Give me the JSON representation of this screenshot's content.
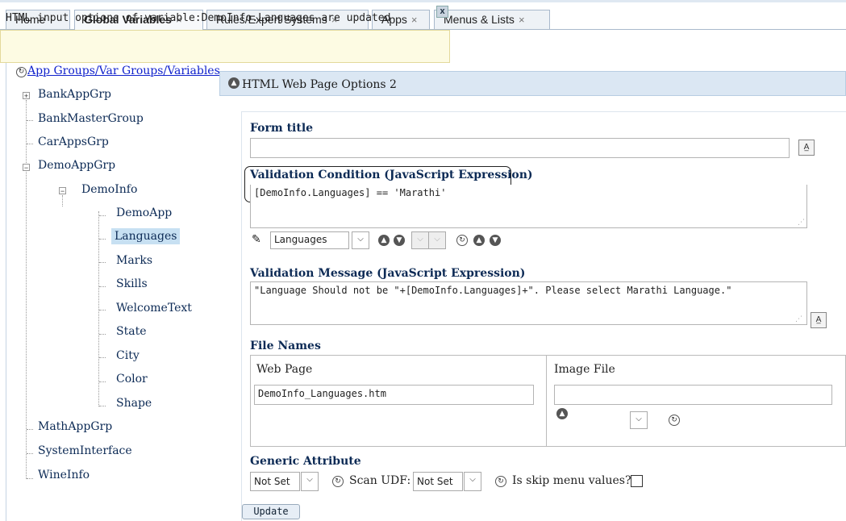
{
  "tabs": [
    {
      "label": "Home"
    },
    {
      "label": "Global Variables",
      "close": "×"
    },
    {
      "label": "Rules/Expert Systems",
      "close": "×"
    },
    {
      "label": "Apps",
      "close": "×"
    },
    {
      "label": "Menus & Lists",
      "close": "×"
    }
  ],
  "notice": {
    "text": "HTML input options of variable:DemoInfo.Languages are updated",
    "close": "x"
  },
  "tree": {
    "root": "App Groups/Var Groups/Variables",
    "nodes": [
      "BankAppGrp",
      "BankMasterGroup",
      "CarAppsGrp",
      "DemoAppGrp",
      "DemoInfo",
      "DemoApp",
      "Languages",
      "Marks",
      "Skills",
      "WelcomeText",
      "State",
      "City",
      "Color",
      "Shape",
      "MathAppGrp",
      "SystemInterface",
      "WineInfo"
    ],
    "selected": "Languages"
  },
  "panel": {
    "title": "HTML Web Page Options 2",
    "form_title": {
      "label": "Form title",
      "value": ""
    },
    "validation_condition": {
      "label": "Validation Condition (JavaScript Expression)",
      "value": "[DemoInfo.Languages] == 'Marathi'",
      "variable_select": "Languages"
    },
    "validation_message": {
      "label": "Validation Message (JavaScript Expression)",
      "value": "\"Language Should not be \"+[DemoInfo.Languages]+\". Please select Marathi Language.\""
    },
    "file_names": {
      "label": "File Names",
      "web_page_label": "Web Page",
      "web_page_value": "DemoInfo_Languages.htm",
      "image_file_label": "Image File",
      "image_file_value": ""
    },
    "generic_attribute": {
      "label": "Generic Attribute",
      "value": "Not Set",
      "scan_udf_label": "Scan UDF:",
      "scan_udf_value": "Not Set",
      "skip_menu_label": "Is skip menu values?"
    },
    "update_label": "Update"
  },
  "colors": {
    "accent": "#dbe7f3",
    "selected": "#c7e0f2",
    "notice_bg": "#fdfbe3"
  }
}
